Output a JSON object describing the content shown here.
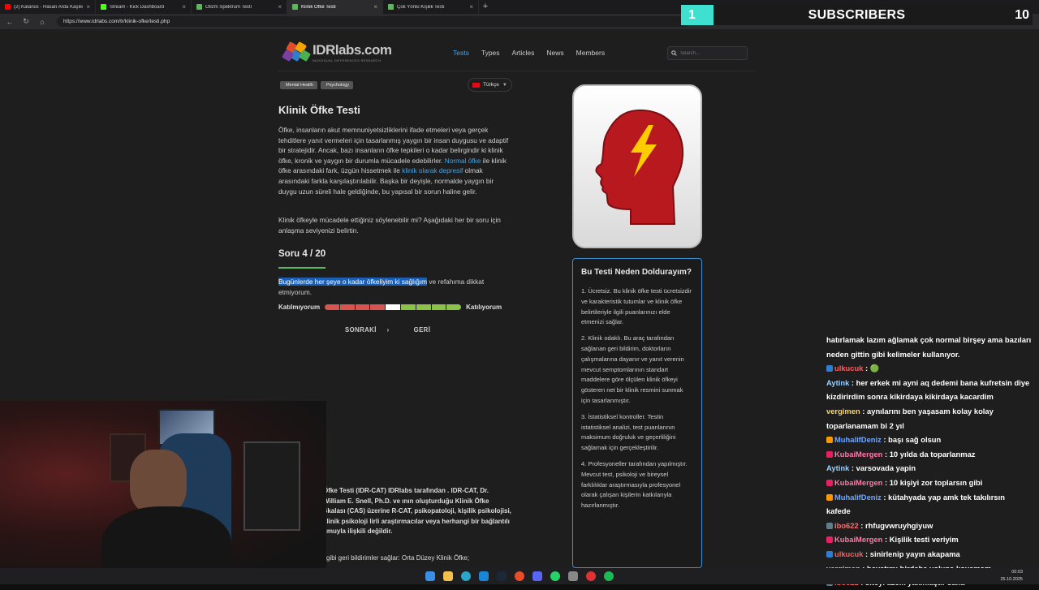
{
  "browser": {
    "tabs": [
      {
        "label": "(2) Katarsis - Hasan Arda Kaşıkçı",
        "icon": "youtube-icon",
        "color": "#ff0000",
        "active": false
      },
      {
        "label": "Stream - Kick Dashboard",
        "icon": "kick-icon",
        "color": "#53fc18",
        "active": false
      },
      {
        "label": "Otizm Spektrum Testi",
        "icon": "idrlabs-icon",
        "color": "#5cb85c",
        "active": false
      },
      {
        "label": "Klinik Öfke Testi",
        "icon": "idrlabs-icon",
        "color": "#5cb85c",
        "active": true
      },
      {
        "label": "Çok Yönlü Kişilik Testi",
        "icon": "idrlabs-icon",
        "color": "#5cb85c",
        "active": false
      }
    ],
    "url": "https://www.idrlabs.com/tr/klinik-ofke/testi.php"
  },
  "overlay": {
    "subscribers_count": "1",
    "subscribers_label": "SUBSCRIBERS",
    "subscribers_goal": "10"
  },
  "site": {
    "logo_name": "IDRlabs.com",
    "logo_tagline": "INDIVIDUAL DIFFERENCES RESEARCH",
    "menu": [
      "Tests",
      "Types",
      "Articles",
      "News",
      "Members"
    ],
    "active_menu": "Tests",
    "search_placeholder": "Search..."
  },
  "article": {
    "tags": [
      "Mental Health",
      "Psychology"
    ],
    "language": "Türkçe",
    "title": "Klinik Öfke Testi",
    "intro_p1_a": "Öfke, insanların akut memnuniyetsizliklerini ifade etmeleri veya gerçek tehditlere yanıt vermeleri için tasarlanmış yaygın bir insan duygusu ve adaptif bir stratejidir. Ancak, bazı insanların öfke tepkileri o kadar belirgindir ki klinik öfke, kronik ve yaygın bir durumla mücadele edebilirler. ",
    "intro_link1": "Normal öfke",
    "intro_p1_b": " ile klinik öfke arasındaki fark, üzgün hissetmek ile ",
    "intro_link2": "klinik olarak depresif",
    "intro_p1_c": " olmak arasındaki farkla karşılaştırılabilir. Başka bir deyişle, normalde yaygın bir duygu uzun süreli hale geldiğinde, bu yapısal bir sorun haline gelir.",
    "intro_p2": "Klinik öfkeyle mücadele ettiğiniz söylenebilir mi? Aşağıdaki her bir soru için anlaşma seviyenizi belirtin.",
    "question_number": "Soru 4 / 20",
    "question_highlighted": "Bugünlerde her şeye o kadar öfkeliyim ki sağlığım",
    "question_rest": "ve refahıma dikkat etmiyorum.",
    "scale_left": "Katılmıyorum",
    "scale_right": "Katılıyorum",
    "scale_selected_index": 4,
    "scale_colors": [
      "#d9534f",
      "#d9534f",
      "#d9534f",
      "#d9534f",
      "#ffffff",
      "#8bc34a",
      "#8bc34a",
      "#8bc34a",
      "#8bc34a"
    ],
    "next_label": "SONRAKİ",
    "back_label": "GERİ",
    "lower_text": "Öfke Testi (IDR-CAT) IDRlabs tarafından . IDR-CAT, Dr. William E. Snell, Ph.D. ve ının oluşturduğu Klinik Öfke Skalası (CAS) üzerine R-CAT, psikopatoloji, kişilik psikolojisi, klinik psikoloji lirli araştırmacılar veya herhangi bir bağlantılı umuyla ilişkili değildir.",
    "lower_text2": "gibi geri bildirimler sağlar: Orta Düzey Klinik Öfke;"
  },
  "why_box": {
    "title": "Bu Testi Neden Doldurayım?",
    "items": [
      "1. Ücretsiz. Bu klinik öfke testi ücretsizdir ve karakteristik tutumlar ve klinik öfke belirtileriyle ilgili puanlarınızı elde etmenizi sağlar.",
      "2. Klinik odaklı. Bu araç tarafından sağlanan geri bildirim, doktorların çalışmalarına dayanır ve yanıt verenin mevcut semptomlarının standart maddelere göre ölçülen klinik öfkeyi gösteren net bir klinik resmini sunmak için tasarlanmıştır.",
      "3. İstatistiksel kontroller. Testin istatistiksel analizi, test puanlarının maksimum doğruluk ve geçerliliğini sağlamak için gerçekleştirilir.",
      "4. Profesyoneller tarafından yapılmıştır. Mevcut test, psikoloji ve bireysel farklılıklar araştırmasıyla profesyonel olarak çalışan kişilerin katkılarıyla hazırlanmıştır."
    ]
  },
  "chat": [
    {
      "user": "",
      "color": "#ffffff",
      "badge": "",
      "text": "hatırlamak lazım ağlamak çok normal birşey ama bazıları"
    },
    {
      "user": "",
      "color": "#ffffff",
      "badge": "",
      "text": "neden gittin gibi kelimeler kullanıyor."
    },
    {
      "user": "ulkucuk",
      "color": "#ff5c5c",
      "badge": "#2d7dd2",
      "text": " : 🟢"
    },
    {
      "user": "Aytink",
      "color": "#9ad0ff",
      "badge": "",
      "text": " : her erkek mi ayni aq dedemi bana kufretsin diye"
    },
    {
      "user": "",
      "color": "#ffffff",
      "badge": "",
      "text": "kizdirirdim sonra kikirdaya kikirdaya kacardim"
    },
    {
      "user": "vergimen",
      "color": "#ffd84d",
      "badge": "",
      "text": " : aynılarını ben yaşasam kolay kolay"
    },
    {
      "user": "",
      "color": "#ffffff",
      "badge": "",
      "text": "toparlanamam bi 2 yıl"
    },
    {
      "user": "MuhalifDeniz",
      "color": "#6ea8ff",
      "badge": "#ff9800",
      "text": " : başı sağ olsun"
    },
    {
      "user": "KubaiMergen",
      "color": "#ff7aa8",
      "badge": "#e91e63",
      "text": " : 10 yılda da toparlanmaz"
    },
    {
      "user": "Aytink",
      "color": "#9ad0ff",
      "badge": "",
      "text": " : varsovada yapin"
    },
    {
      "user": "KubaiMergen",
      "color": "#ff7aa8",
      "badge": "#e91e63",
      "text": " : 10 kişiyi zor toplarsın gibi"
    },
    {
      "user": "MuhalifDeniz",
      "color": "#6ea8ff",
      "badge": "#ff9800",
      "text": " : kütahyada yap amk tek takılırsın"
    },
    {
      "user": "",
      "color": "#ffffff",
      "badge": "",
      "text": "kafede"
    },
    {
      "user": "ibo622",
      "color": "#ff6b6b",
      "badge": "#607d8b",
      "text": " : rhfugvwruyhgiyuw"
    },
    {
      "user": "KubaiMergen",
      "color": "#ff7aa8",
      "badge": "#e91e63",
      "text": " : Kişilik testi veriyim"
    },
    {
      "user": "ulkucuk",
      "color": "#ff5c5c",
      "badge": "#2d7dd2",
      "text": " : sinirlenip yayın akapama"
    },
    {
      "user": "vergimen",
      "color": "#ffd84d",
      "badge": "",
      "text": " : hayatımı birdaha yoluna koyamam"
    },
    {
      "user": "ibo622",
      "color": "#ff6b6b",
      "badge": "#607d8b",
      "text": " : siteyi azcık yakınlaştır sana"
    }
  ],
  "taskbar": {
    "time": "00:03",
    "date": "25.10.2025"
  }
}
